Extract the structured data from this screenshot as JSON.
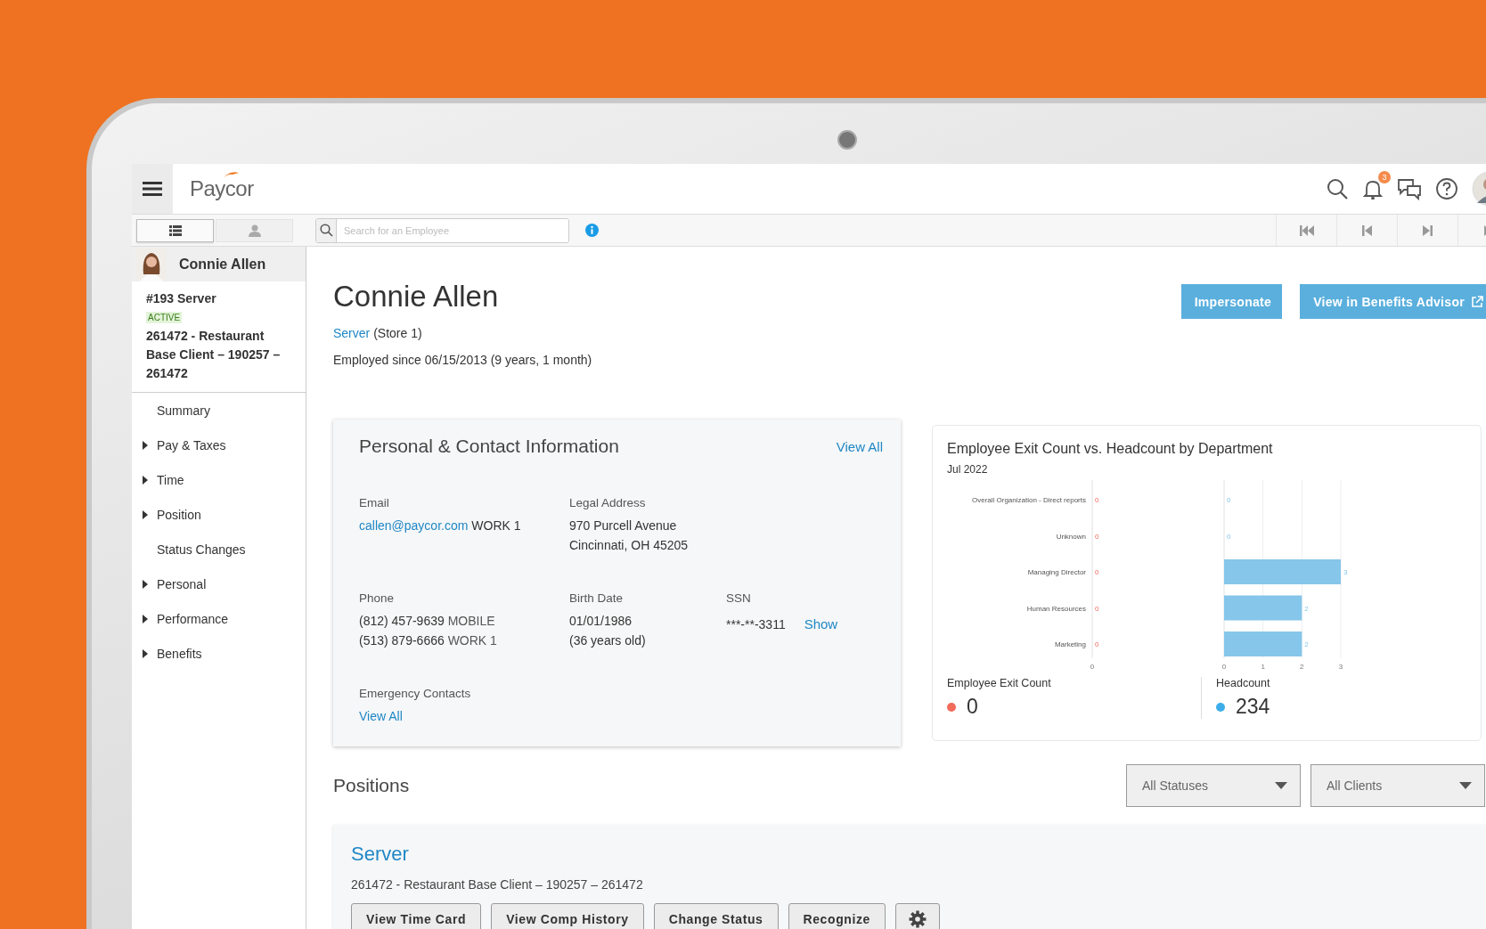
{
  "brand": {
    "name": "Paycor"
  },
  "top_bar": {
    "notification_count": "3"
  },
  "toolbar": {
    "view_toggle": [
      {
        "kind": "list",
        "selected": true
      },
      {
        "kind": "person",
        "selected": false
      }
    ],
    "search": {
      "placeholder": "Search for an Employee"
    },
    "nav_buttons": [
      {
        "kind": "first"
      },
      {
        "kind": "previous"
      },
      {
        "kind": "next"
      },
      {
        "kind": "last"
      }
    ]
  },
  "sidebar": {
    "employee": {
      "name": "Connie Allen",
      "title": "#193 Server",
      "status": "ACTIVE",
      "client": "261472 - Restaurant Base Client – 190257 – 261472"
    },
    "items": [
      {
        "label": "Summary",
        "has_children": false
      },
      {
        "label": "Pay & Taxes",
        "has_children": true
      },
      {
        "label": "Time",
        "has_children": true
      },
      {
        "label": "Position",
        "has_children": true
      },
      {
        "label": "Status Changes",
        "has_children": false
      },
      {
        "label": "Personal",
        "has_children": true
      },
      {
        "label": "Performance",
        "has_children": true
      },
      {
        "label": "Benefits",
        "has_children": true
      }
    ]
  },
  "header": {
    "name": "Connie Allen",
    "position_link": "Server",
    "position_detail": "(Store 1)",
    "employed": "Employed since 06/15/2013 (9 years, 1 month)",
    "buttons": [
      {
        "label": "Impersonate",
        "external": false
      },
      {
        "label": "View in Benefits Advisor",
        "external": true
      }
    ]
  },
  "contact_card": {
    "title": "Personal & Contact Information",
    "view_all": "View All",
    "email": {
      "label": "Email",
      "value": "callen@paycor.com",
      "type": "WORK 1"
    },
    "address": {
      "label": "Legal Address",
      "lines": [
        "970 Purcell Avenue",
        "Cincinnati, OH 45205"
      ]
    },
    "phone": {
      "label": "Phone",
      "numbers": [
        {
          "value": "(812) 457-9639",
          "type": "MOBILE"
        },
        {
          "value": "(513) 879-6666",
          "type": "WORK 1"
        }
      ]
    },
    "birth_date": {
      "label": "Birth Date",
      "lines": [
        "01/01/1986",
        "(36 years old)"
      ]
    },
    "ssn": {
      "label": "SSN",
      "value": "***-**-3311",
      "action": "Show"
    },
    "emergency": {
      "label": "Emergency Contacts",
      "link": "View All"
    }
  },
  "chart_card": {
    "title": "Employee Exit Count vs. Headcount by Department",
    "subtitle": "Jul 2022",
    "panels": [
      {
        "kind": "labels",
        "name": "Employee Exit Count",
        "rows": [
          {
            "category": "Overall Organization - Direct reports",
            "value": "0"
          },
          {
            "category": "Unknown",
            "value": "0"
          },
          {
            "category": "Managing Director",
            "value": "0"
          },
          {
            "category": "Human Resources",
            "value": "0"
          },
          {
            "category": "Marketing",
            "value": "0"
          }
        ],
        "axis_label": "0",
        "total": "0",
        "color": "#f26b5b"
      },
      {
        "kind": "chart",
        "chart_data": {
          "type": "bar",
          "orientation": "horizontal",
          "series": [
            {
              "name": "Headcount",
              "color": "#85c6ea",
              "values": [
                0,
                0,
                3,
                2,
                2
              ]
            }
          ],
          "xticks": [
            0,
            1,
            2,
            3
          ],
          "xlim": [
            0,
            3
          ],
          "data_labels": true
        },
        "total": "234",
        "color": "#3daee9"
      }
    ]
  },
  "positions": {
    "title": "Positions",
    "filters": [
      "All Statuses",
      "All Clients"
    ],
    "items": [
      {
        "title": "Server",
        "detail": "261472 - Restaurant Base Client – 190257 – 261472",
        "actions": [
          "View Time Card",
          "View Comp History",
          "Change Status",
          "Recognize"
        ]
      }
    ]
  }
}
